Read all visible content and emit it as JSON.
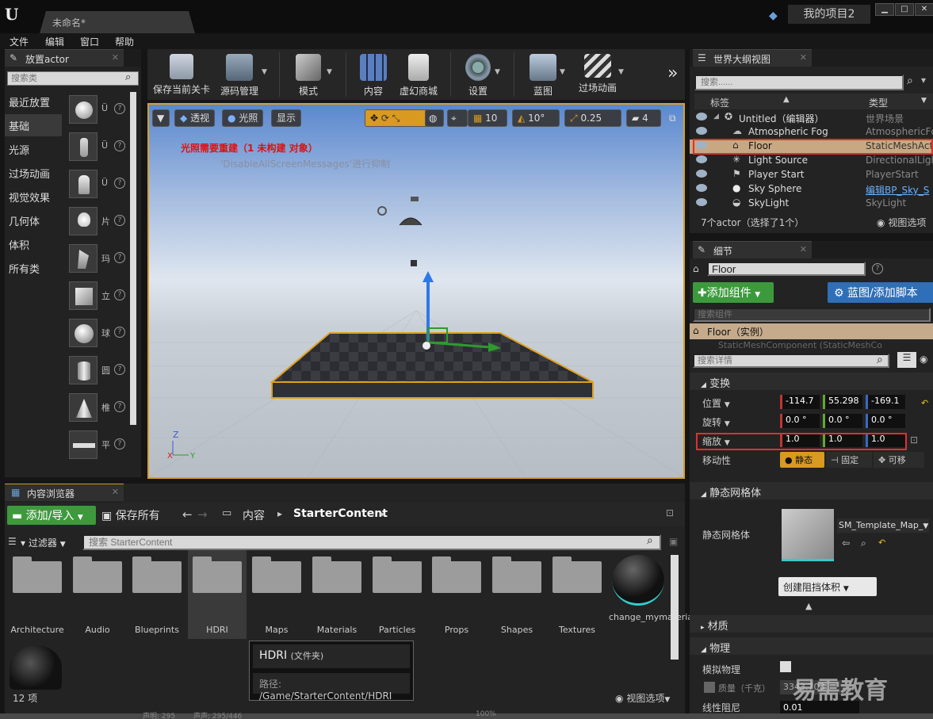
{
  "window": {
    "doc_tab": "未命名*",
    "project_name": "我的项目2"
  },
  "menu": [
    "文件",
    "编辑",
    "窗口",
    "帮助"
  ],
  "place_actor": {
    "tab": "放置actor",
    "search_placeholder": "搜索类",
    "categories": [
      "最近放置",
      "基础",
      "光源",
      "过场动画",
      "视觉效果",
      "几何体",
      "体积",
      "所有类"
    ],
    "selected_category": "基础",
    "item_labels": [
      "Ü",
      "Ü",
      "Ü",
      "片",
      "玛",
      "立",
      "球",
      "圆",
      "椎",
      "平"
    ]
  },
  "toolbar": {
    "buttons": [
      "保存当前关卡",
      "源码管理",
      "模式",
      "内容",
      "虚幻商城",
      "设置",
      "蓝图",
      "过场动画"
    ],
    "more": "»"
  },
  "viewport": {
    "perspective": "透视",
    "lighting": "光照",
    "show": "显示",
    "grid_snap": "10",
    "rot_snap": "10°",
    "scale_snap": "0.25",
    "cam_speed": "4",
    "warning": "光照需要重建（1 未构建 对象）",
    "warning_sub": "'DisableAllScreenMessages'进行抑制"
  },
  "content_browser": {
    "tab": "内容浏览器",
    "add_import": "添加/导入",
    "save_all": "保存所有",
    "path_root": "内容",
    "path_current": "StarterContent",
    "filter": "过滤器",
    "search_placeholder": "搜索 StarterContent",
    "assets": [
      "Architecture",
      "Audio",
      "Blueprints",
      "HDRI",
      "Maps",
      "Materials",
      "Particles",
      "Props",
      "Shapes",
      "Textures",
      "change_mymaterial"
    ],
    "selected_asset": "HDRI",
    "count": "12 项",
    "view_options": "视图选项"
  },
  "tooltip": {
    "title": "HDRI",
    "title_kind": "(文件夹)",
    "path_label": "路径:",
    "path": "/Game/StarterContent/HDRI"
  },
  "outliner": {
    "tab": "世界大纲视图",
    "search_placeholder": "搜索......",
    "col_label": "标签",
    "col_type": "类型",
    "rows": [
      {
        "name": "Untitled（编辑器）",
        "type": "世界场景"
      },
      {
        "name": "Atmospheric Fog",
        "type": "AtmosphericFc"
      },
      {
        "name": "Floor",
        "type": "StaticMeshActo"
      },
      {
        "name": "Light Source",
        "type": "DirectionalLigh"
      },
      {
        "name": "Player Start",
        "type": "PlayerStart"
      },
      {
        "name": "Sky Sphere",
        "type": "编辑BP_Sky_S"
      },
      {
        "name": "SkyLight",
        "type": "SkyLight"
      }
    ],
    "footer": "7个actor（选择了1个）",
    "view_options": "视图选项"
  },
  "details": {
    "tab": "细节",
    "name_value": "Floor",
    "add_component": "添加组件",
    "blueprint_btn": "蓝图/添加脚本",
    "comp_search_placeholder": "搜索组件",
    "instance": "Floor（实例）",
    "component_cut": "StaticMeshComponent (StaticMeshCo",
    "search_placeholder": "搜索详情",
    "sec_transform": "变换",
    "location_label": "位置",
    "location": [
      "-114.7",
      "55.298",
      "-169.1"
    ],
    "rotation_label": "旋转",
    "rotation": [
      "0.0 °",
      "0.0 °",
      "0.0 °"
    ],
    "scale_label": "缩放",
    "scale": [
      "1.0",
      "1.0",
      "1.0"
    ],
    "mobility_label": "移动性",
    "mobility": [
      "静态",
      "固定",
      "可移"
    ],
    "sec_static_mesh": "静态网格体",
    "static_mesh_label": "静态网格体",
    "static_mesh_value": "SM_Template_Map_",
    "create_blocking": "创建阻挡体积",
    "sec_material": "材质",
    "sec_physics": "物理",
    "simulate_label": "模拟物理",
    "mass_label": "质量（千克）",
    "mass_value": "3343.703",
    "linear_damping_label": "线性阻尼",
    "linear_damping_value": "0.01"
  },
  "watermark": "易需教育",
  "status_strip": [
    "声明: 295",
    "声声: 295/446",
    "100%"
  ]
}
